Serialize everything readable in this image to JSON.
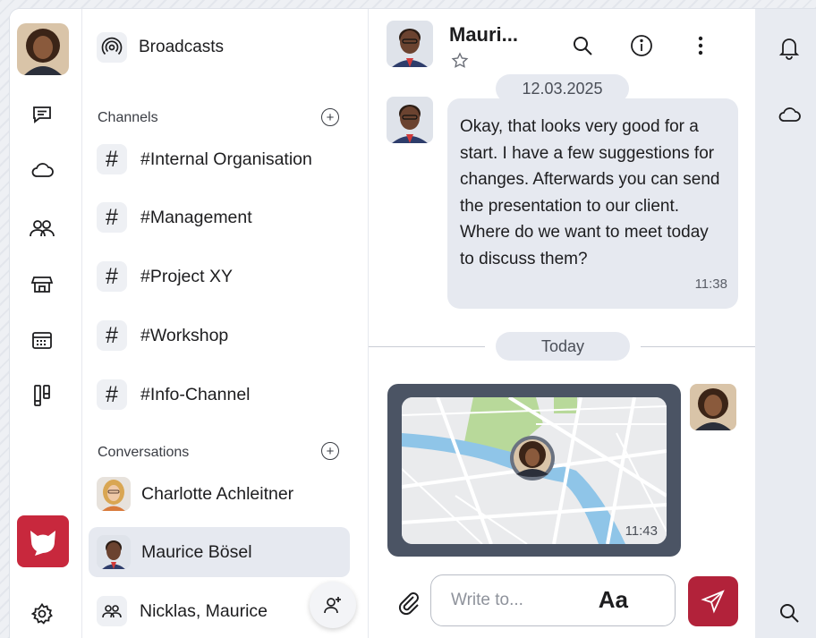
{
  "colors": {
    "accent": "#b2223a",
    "logo_bg": "#c8283d",
    "bubble_bg": "#e6e9f0",
    "map_frame": "#4b5464",
    "right_rail_bg": "#e8ebf1"
  },
  "rail": {
    "icons": [
      "chat-icon",
      "cloud-icon",
      "people-icon",
      "store-icon",
      "calendar-icon",
      "kanban-icon",
      "settings-icon"
    ]
  },
  "list": {
    "broadcasts_label": "Broadcasts",
    "channels_header": "Channels",
    "channels": [
      {
        "hash": "#",
        "name": "#Internal Organisation"
      },
      {
        "hash": "#",
        "name": "#Management"
      },
      {
        "hash": "#",
        "name": "#Project XY"
      },
      {
        "hash": "#",
        "name": "#Workshop"
      },
      {
        "hash": "#",
        "name": "#Info-Channel"
      }
    ],
    "conversations_header": "Conversations",
    "conversations": [
      {
        "name": "Charlotte Achleitner"
      },
      {
        "name": "Maurice Bösel"
      },
      {
        "name": "Nicklas, Maurice"
      }
    ]
  },
  "chat": {
    "title": "Mauri...",
    "date_1": "12.03.2025",
    "message_text": "Okay, that looks very good for a start. I have a few suggestions for changes. Afterwards you can send the presentation to our client. Where do we want to meet today to discuss them?",
    "message_time": "11:38",
    "date_2": "Today",
    "map_time": "11:43",
    "composer_placeholder": "Write to...",
    "composer_format": "Aa"
  }
}
